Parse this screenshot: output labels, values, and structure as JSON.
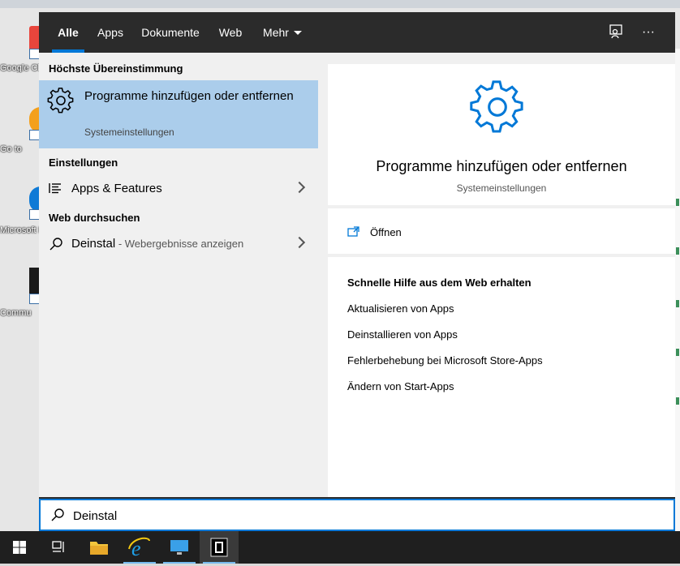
{
  "desktop": {
    "icons": [
      {
        "label": "Google Chrome",
        "color": "#e8453c"
      },
      {
        "label": "Go to",
        "color": "#f4a01c"
      },
      {
        "label": "Microsoft Edge",
        "color": "#0f7ad6"
      },
      {
        "label": "Commu",
        "color": "#1a1a1a"
      }
    ]
  },
  "nav": {
    "tabs": [
      {
        "label": "Alle",
        "active": true
      },
      {
        "label": "Apps"
      },
      {
        "label": "Dokumente"
      },
      {
        "label": "Web"
      },
      {
        "label": "Mehr"
      }
    ],
    "feedback_icon": "feedback-icon",
    "more_icon": "ellipsis-icon"
  },
  "left": {
    "best_match_header": "Höchste Übereinstimmung",
    "best_match": {
      "title": "Programme hinzufügen oder entfernen",
      "subtitle": "Systemeinstellungen",
      "icon": "gear-icon"
    },
    "settings_header": "Einstellungen",
    "settings_item": {
      "label": "Apps & Features",
      "icon": "list-icon"
    },
    "web_header": "Web durchsuchen",
    "web_item": {
      "label": "Deinstal",
      "suffix": " - Webergebnisse anzeigen",
      "icon": "search-icon"
    }
  },
  "right": {
    "title": "Programme hinzufügen oder entfernen",
    "subtitle": "Systemeinstellungen",
    "open_label": "Öffnen",
    "help_header": "Schnelle Hilfe aus dem Web erhalten",
    "help_links": [
      "Aktualisieren von Apps",
      "Deinstallieren von Apps",
      "Fehlerbehebung bei Microsoft Store-Apps",
      "Ändern von Start-Apps"
    ]
  },
  "search": {
    "value": "Deinstal"
  },
  "taskbar": {
    "items": [
      "windows-start-icon",
      "task-view-icon",
      "file-explorer-icon",
      "internet-explorer-icon",
      "remote-desktop-icon",
      "terminal-icon"
    ]
  },
  "colors": {
    "accent": "#0078d7",
    "selected": "#abcdeb",
    "panel_dark": "#2b2b2b"
  }
}
